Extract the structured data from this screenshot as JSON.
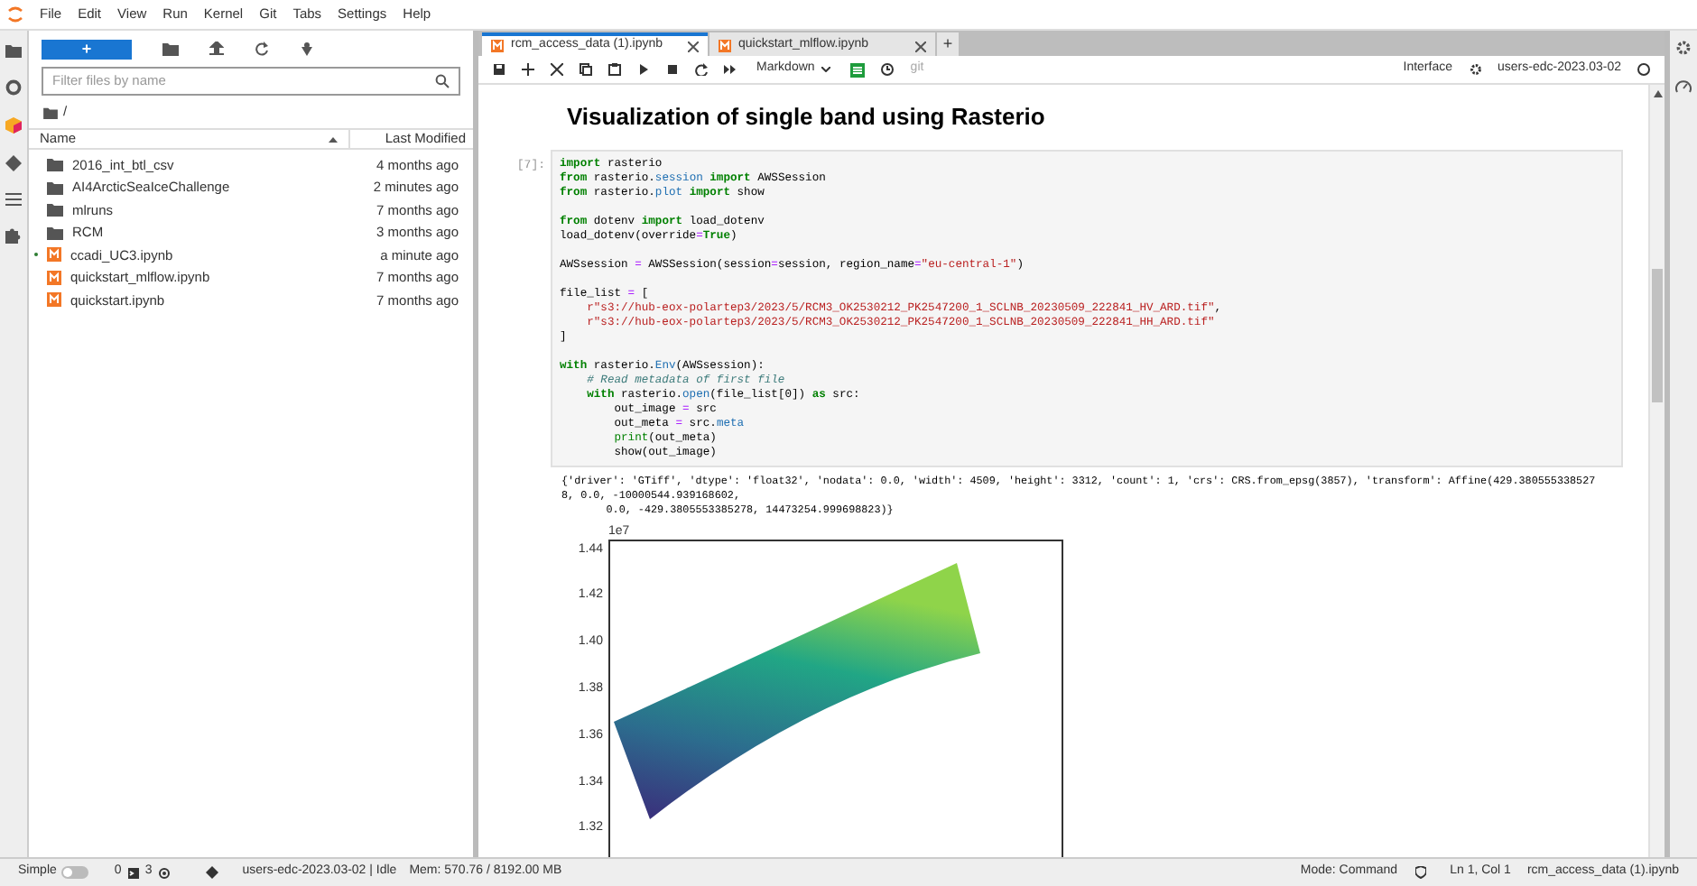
{
  "menu": [
    "File",
    "Edit",
    "View",
    "Run",
    "Kernel",
    "Git",
    "Tabs",
    "Settings",
    "Help"
  ],
  "file_browser": {
    "new_button": "+",
    "filter": {
      "placeholder": "Filter files by name"
    },
    "path": "/",
    "columns": [
      "Name",
      "Last Modified"
    ],
    "rows": [
      {
        "name": "2016_int_btl_csv",
        "modified": "4 months ago",
        "kind": "folder",
        "running": false
      },
      {
        "name": "AI4ArcticSeaIceChallenge",
        "modified": "2 minutes ago",
        "kind": "folder",
        "running": false
      },
      {
        "name": "mlruns",
        "modified": "7 months ago",
        "kind": "folder",
        "running": false
      },
      {
        "name": "RCM",
        "modified": "3 months ago",
        "kind": "folder",
        "running": false
      },
      {
        "name": "ccadi_UC3.ipynb",
        "modified": "a minute ago",
        "kind": "notebook",
        "running": true
      },
      {
        "name": "quickstart_mlflow.ipynb",
        "modified": "7 months ago",
        "kind": "notebook",
        "running": false
      },
      {
        "name": "quickstart.ipynb",
        "modified": "7 months ago",
        "kind": "notebook",
        "running": false
      }
    ]
  },
  "tabs": [
    {
      "label": "rcm_access_data (1).ipynb",
      "selected": true
    },
    {
      "label": "quickstart_mlflow.ipynb",
      "selected": false
    }
  ],
  "new_tab": "+",
  "toolbar": {
    "cell_type": "Markdown",
    "git": "git",
    "interface": "Interface",
    "kernel": "users-edc-2023.03-02"
  },
  "notebook": {
    "heading": "Visualization of single band using Rasterio",
    "prompt": "[7]:",
    "code_blocks": [
      [
        [
          {
            "kind": "kw",
            "text": "import"
          },
          {
            "kind": "plain",
            "text": " rasterio"
          }
        ],
        [
          {
            "kind": "kw",
            "text": "from"
          },
          {
            "kind": "plain",
            "text": " rasterio."
          },
          {
            "kind": "attr",
            "text": "session"
          },
          {
            "kind": "kw",
            "text": " import"
          },
          {
            "kind": "plain",
            "text": " AWSSession"
          }
        ],
        [
          {
            "kind": "kw",
            "text": "from"
          },
          {
            "kind": "plain",
            "text": " rasterio."
          },
          {
            "kind": "attr",
            "text": "plot"
          },
          {
            "kind": "kw",
            "text": " import"
          },
          {
            "kind": "plain",
            "text": " show"
          }
        ]
      ],
      [
        [
          {
            "kind": "kw",
            "text": "from"
          },
          {
            "kind": "plain",
            "text": " dotenv "
          },
          {
            "kind": "kw",
            "text": "import"
          },
          {
            "kind": "plain",
            "text": " load_dotenv"
          }
        ],
        [
          {
            "kind": "plain",
            "text": "load_dotenv(override"
          },
          {
            "kind": "op",
            "text": "="
          },
          {
            "kind": "kw",
            "text": "True"
          },
          {
            "kind": "plain",
            "text": ")"
          }
        ]
      ],
      [
        [
          {
            "kind": "plain",
            "text": "AWSsession "
          },
          {
            "kind": "op",
            "text": "="
          },
          {
            "kind": "plain",
            "text": " AWSSession(session"
          },
          {
            "kind": "op",
            "text": "="
          },
          {
            "kind": "plain",
            "text": "session, region_name"
          },
          {
            "kind": "op",
            "text": "="
          },
          {
            "kind": "str",
            "text": "\"eu-central-1\""
          },
          {
            "kind": "plain",
            "text": ")"
          }
        ]
      ],
      [
        [
          {
            "kind": "plain",
            "text": "file_list "
          },
          {
            "kind": "op",
            "text": "="
          },
          {
            "kind": "plain",
            "text": " ["
          }
        ],
        [
          {
            "kind": "str",
            "text": "    r\"s3://hub-eox-polartep3/2023/5/RCM3_OK2530212_PK2547200_1_SCLNB_20230509_222841_HV_ARD.tif\""
          },
          {
            "kind": "plain",
            "text": ","
          }
        ],
        [
          {
            "kind": "str",
            "text": "    r\"s3://hub-eox-polartep3/2023/5/RCM3_OK2530212_PK2547200_1_SCLNB_20230509_222841_HH_ARD.tif\""
          }
        ],
        [
          {
            "kind": "plain",
            "text": "]"
          }
        ]
      ],
      [
        [
          {
            "kind": "kw",
            "text": "with"
          },
          {
            "kind": "plain",
            "text": " rasterio."
          },
          {
            "kind": "attr",
            "text": "Env"
          },
          {
            "kind": "plain",
            "text": "(AWSsession):"
          }
        ],
        [
          {
            "kind": "comment",
            "text": "    # Read metadata of first file"
          }
        ],
        [
          {
            "kind": "kw",
            "text": "    with"
          },
          {
            "kind": "plain",
            "text": " rasterio."
          },
          {
            "kind": "attr",
            "text": "open"
          },
          {
            "kind": "plain",
            "text": "(file_list[0]) "
          },
          {
            "kind": "kw",
            "text": "as"
          },
          {
            "kind": "plain",
            "text": " src:"
          }
        ],
        [
          {
            "kind": "plain",
            "text": "        out_image "
          },
          {
            "kind": "op",
            "text": "="
          },
          {
            "kind": "plain",
            "text": " src"
          }
        ],
        [
          {
            "kind": "plain",
            "text": "        out_meta "
          },
          {
            "kind": "op",
            "text": "="
          },
          {
            "kind": "plain",
            "text": " src."
          },
          {
            "kind": "attr",
            "text": "meta"
          }
        ],
        [
          {
            "kind": "builtin",
            "text": "        print"
          },
          {
            "kind": "plain",
            "text": "(out_meta)"
          }
        ],
        [
          {
            "kind": "plain",
            "text": "        show(out_image)"
          }
        ]
      ]
    ],
    "output": [
      "{'driver': 'GTiff', 'dtype': 'float32', 'nodata': 0.0, 'width': 4509, 'height': 3312, 'count': 1, 'crs': CRS.from_epsg(3857), 'transform': Affine(429.380555338527",
      "8, 0.0, -10000544.939168602,",
      "       0.0, -429.3805553385278, 14473254.999698823)}"
    ],
    "plot": {
      "exponent": "1e7",
      "yticks": [
        "1.44",
        "1.42",
        "1.40",
        "1.38",
        "1.36",
        "1.34",
        "1.32"
      ]
    }
  },
  "status_bar": {
    "simple_label": "Simple",
    "simple_on": false,
    "terminals": "0",
    "kernels": "3",
    "kernel_status": "users-edc-2023.03-02 | Idle",
    "memory": "Mem: 570.76 / 8192.00 MB",
    "mode": "Mode: Command",
    "cursor": "Ln 1, Col 1",
    "file": "rcm_access_data (1).ipynb"
  }
}
